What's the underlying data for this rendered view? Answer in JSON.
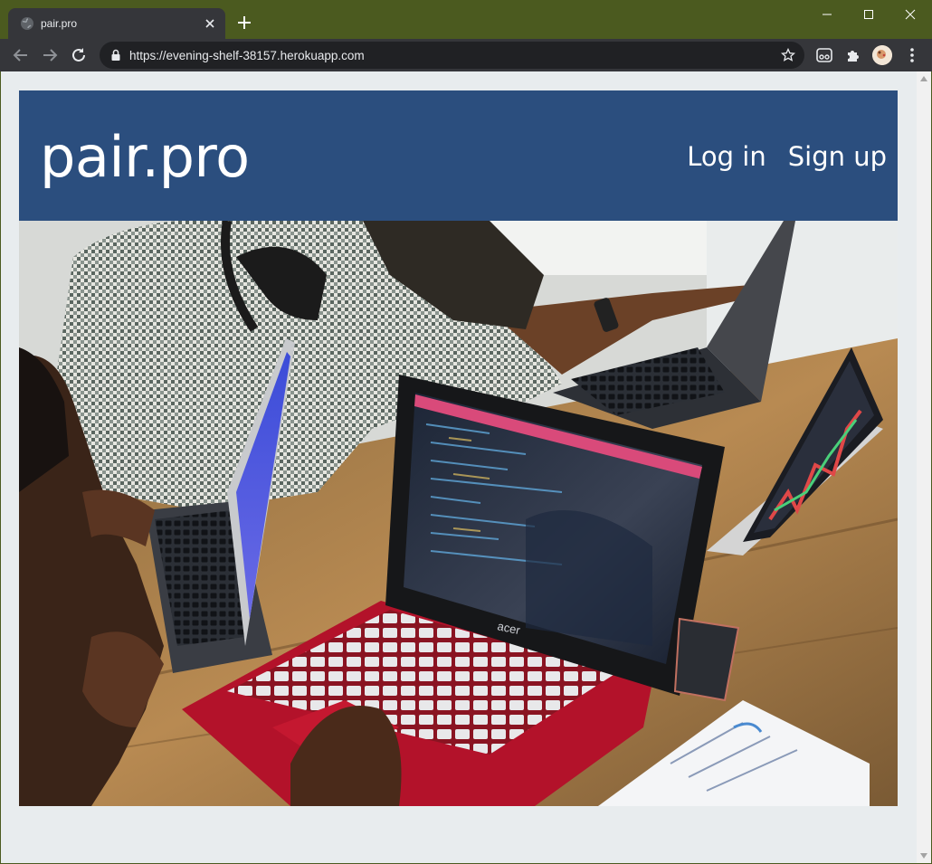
{
  "browser": {
    "tab_title": "pair.pro",
    "url": "https://evening-shelf-38157.herokuapp.com"
  },
  "site": {
    "brand": "pair.pro",
    "nav": {
      "login": "Log in",
      "signup": "Sign up"
    },
    "hero_alt": "Photo of people working together on laptops at a wooden table",
    "hero_laptop_brand": "acer"
  },
  "colors": {
    "header_bg": "#2b4e7e",
    "page_bg": "#e8ecee",
    "window_frame": "#4b5a1f",
    "chrome_toolbar": "#35363a",
    "laptop_red": "#b3122a"
  },
  "icons": [
    "globe-icon",
    "close-icon",
    "plus-icon",
    "minimize-icon",
    "maximize-icon",
    "window-close-icon",
    "back-arrow-icon",
    "forward-arrow-icon",
    "reload-icon",
    "lock-icon",
    "star-icon",
    "extension-icon",
    "puzzle-icon",
    "profile-avatar",
    "more-vert-icon"
  ]
}
